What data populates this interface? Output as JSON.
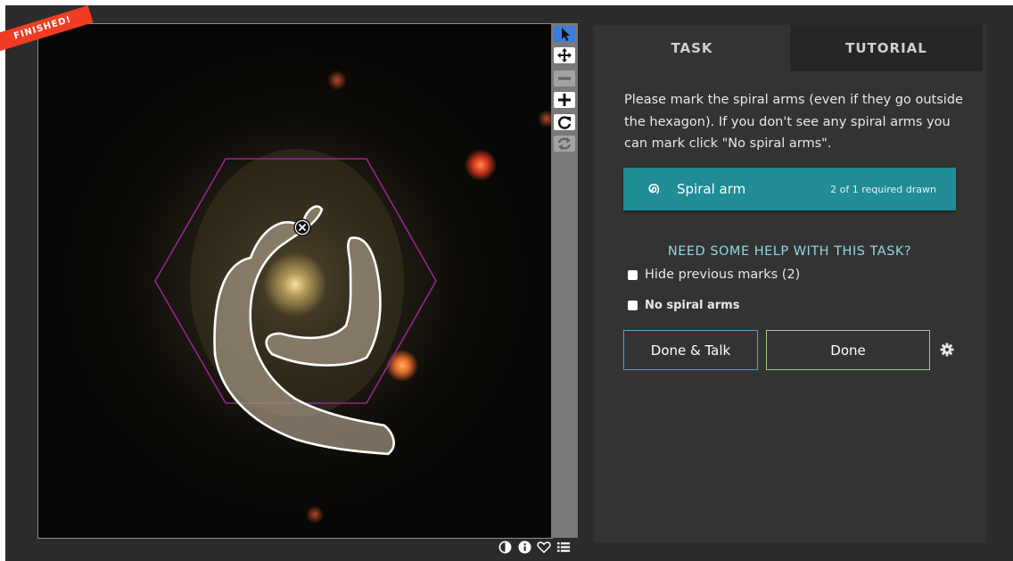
{
  "viewer": {
    "banner": "FINISHED!",
    "marker_icon": "close-circle-icon"
  },
  "toolbar": {
    "tools": [
      {
        "name": "annotate",
        "icon": "cursor-icon",
        "state": "active"
      },
      {
        "name": "move",
        "icon": "move-icon",
        "state": "normal"
      },
      {
        "name": "zoom-out",
        "icon": "minus-icon",
        "state": "disabled"
      },
      {
        "name": "zoom-in",
        "icon": "plus-icon",
        "state": "normal"
      },
      {
        "name": "rotate",
        "icon": "rotate-icon",
        "state": "normal"
      },
      {
        "name": "reset",
        "icon": "reset-icon",
        "state": "disabled"
      }
    ],
    "bottom_icons": [
      "invert-icon",
      "info-icon",
      "heart-icon",
      "collections-icon"
    ]
  },
  "task_panel": {
    "tabs": [
      "TASK",
      "TUTORIAL"
    ],
    "active_tab": "TASK",
    "instructions": "Please mark the spiral arms (even if they go outside the hexagon). If you don't see any spiral arms you can mark click \"No spiral arms\".",
    "tool": {
      "icon": "spiral-icon",
      "label": "Spiral arm",
      "count": "2 of 1 required drawn",
      "color": "#1f8c96"
    },
    "help_link": "NEED SOME HELP WITH THIS TASK?",
    "hide_marks": "Hide previous marks (2)",
    "no_spiral": "No spiral arms",
    "done_talk": "Done & Talk",
    "done": "Done",
    "settings_icon": "gear-icon"
  }
}
